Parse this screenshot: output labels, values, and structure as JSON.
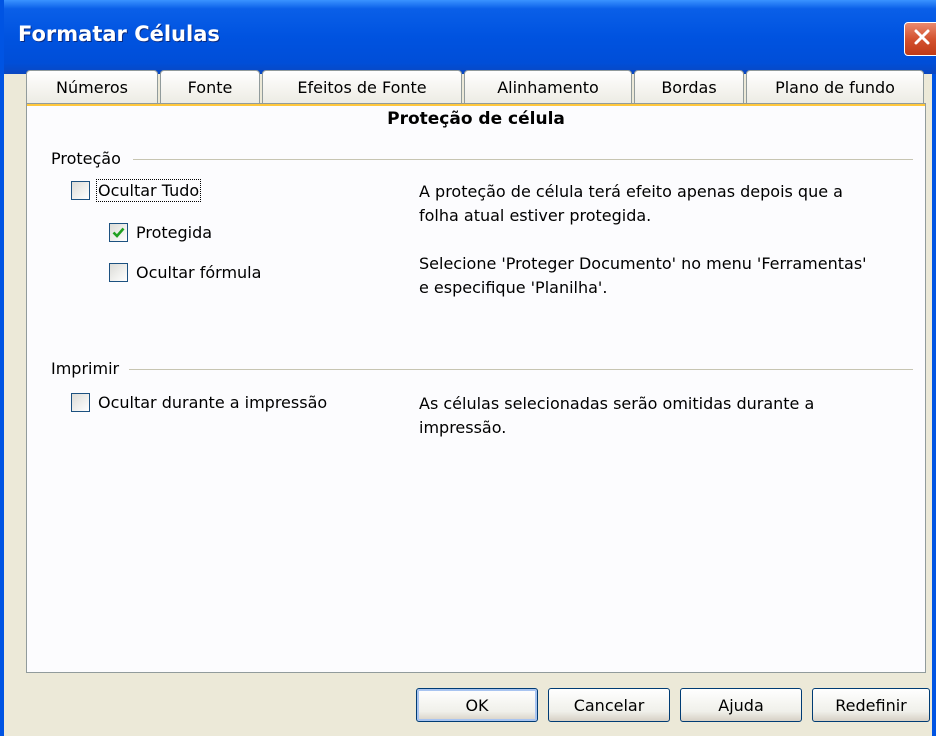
{
  "window": {
    "title": "Formatar Células"
  },
  "tabs": [
    {
      "label": "Números"
    },
    {
      "label": "Fonte"
    },
    {
      "label": "Efeitos de Fonte"
    },
    {
      "label": "Alinhamento"
    },
    {
      "label": "Bordas"
    },
    {
      "label": "Plano de fundo"
    }
  ],
  "active_tab": {
    "label": "Proteção de célula"
  },
  "protection": {
    "group_label": "Proteção",
    "hide_all": {
      "label": "Ocultar Tudo",
      "checked": false
    },
    "protected": {
      "label": "Protegida",
      "checked": true
    },
    "hide_formula": {
      "label": "Ocultar fórmula",
      "checked": false
    },
    "note1": "A proteção de célula terá efeito apenas depois que a\nfolha atual estiver protegida.",
    "note2": "Selecione 'Proteger Documento' no menu 'Ferramentas'\ne especifique 'Planilha'."
  },
  "print": {
    "group_label": "Imprimir",
    "hide_print": {
      "label": "Ocultar durante a impressão",
      "checked": false
    },
    "note": "As células selecionadas serão omitidas durante a\nimpressão."
  },
  "buttons": {
    "ok": "OK",
    "cancel": "Cancelar",
    "help": "Ajuda",
    "reset": "Redefinir"
  },
  "colors": {
    "titlebar": "#0053e0",
    "close_button": "#d4522f",
    "check_mark": "#21a121",
    "active_tab_highlight": "#ffc73c"
  },
  "icons": {
    "close": "close-icon",
    "check": "check-icon"
  }
}
